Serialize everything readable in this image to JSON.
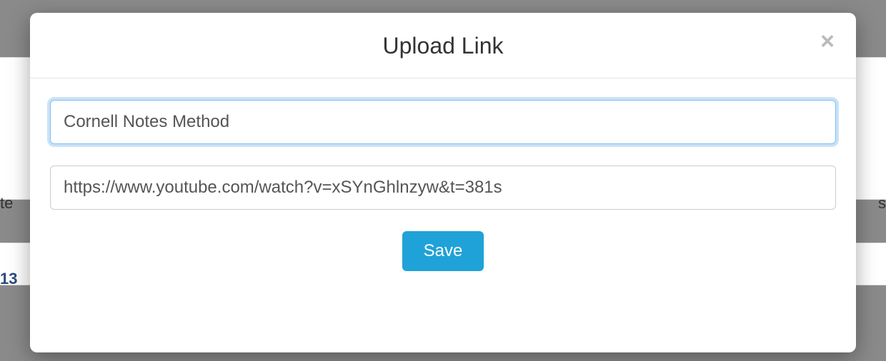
{
  "modal": {
    "title": "Upload Link",
    "close_label": "×",
    "title_input": {
      "value": "Cornell Notes Method",
      "placeholder": ""
    },
    "link_input": {
      "value": "https://www.youtube.com/watch?v=xSYnGhlnzyw&t=381s",
      "placeholder": ""
    },
    "save_label": "Save"
  },
  "background": {
    "left_fragment_1": "te",
    "right_fragment_1": "s",
    "left_fragment_2": "13"
  }
}
